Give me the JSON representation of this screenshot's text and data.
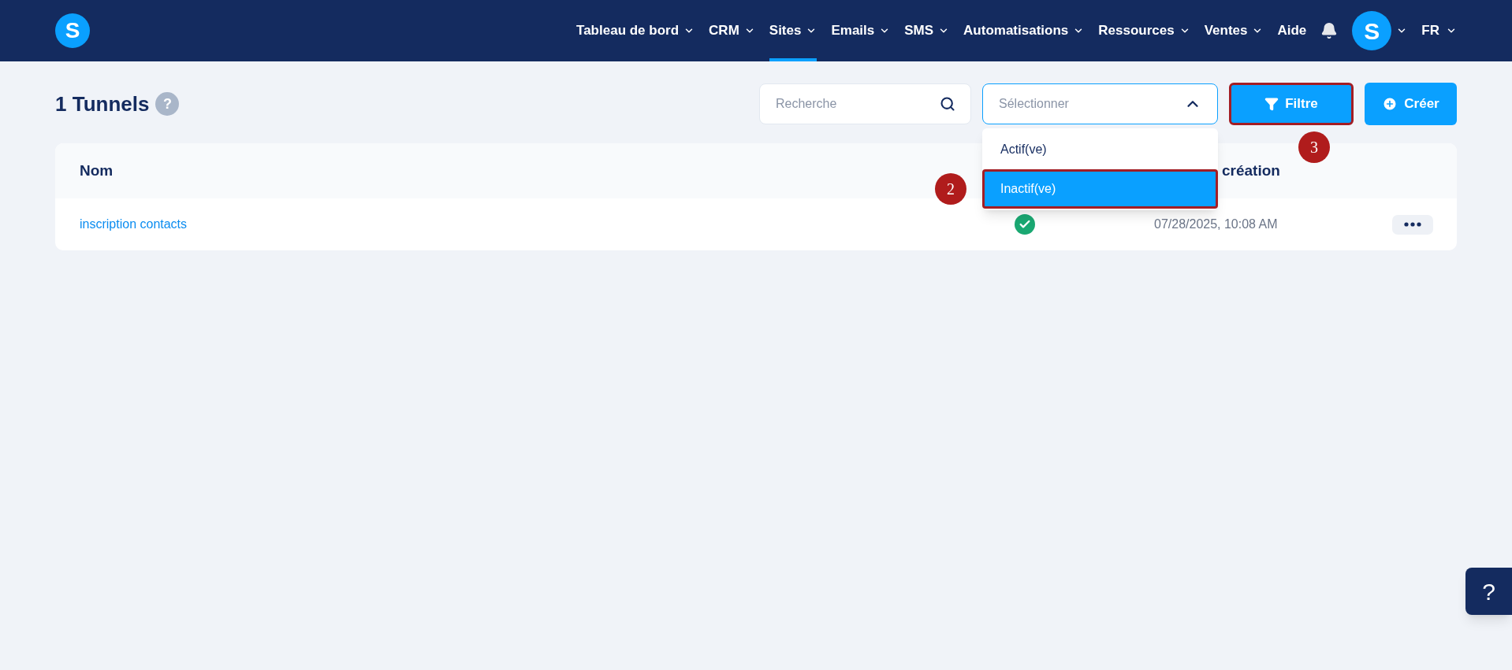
{
  "header": {
    "logo": "S",
    "nav": [
      {
        "label": "Tableau de bord",
        "selected": false,
        "caret": true
      },
      {
        "label": "CRM",
        "selected": false,
        "caret": true
      },
      {
        "label": "Sites",
        "selected": true,
        "caret": true
      },
      {
        "label": "Emails",
        "selected": false,
        "caret": true
      },
      {
        "label": "SMS",
        "selected": false,
        "caret": true
      },
      {
        "label": "Automatisations",
        "selected": false,
        "caret": true
      },
      {
        "label": "Ressources",
        "selected": false,
        "caret": true
      },
      {
        "label": "Ventes",
        "selected": false,
        "caret": true
      },
      {
        "label": "Aide",
        "selected": false,
        "caret": false
      }
    ],
    "avatar": "S",
    "language": "FR"
  },
  "page": {
    "title": "1 Tunnels",
    "help": "?"
  },
  "search": {
    "placeholder": "Recherche"
  },
  "status_select": {
    "placeholder": "Sélectionner",
    "expanded": true,
    "options": [
      {
        "label": "Actif(ve)",
        "selected": false,
        "highlighted": false
      },
      {
        "label": "Inactif(ve)",
        "selected": true,
        "highlighted": true,
        "step": "2"
      }
    ]
  },
  "filter_button": {
    "label": "Filtre",
    "highlighted": true,
    "step": "3"
  },
  "create_button": {
    "label": "Créer"
  },
  "table": {
    "columns": [
      "Nom",
      "création"
    ],
    "rows": [
      {
        "name": "inscription contacts",
        "active": true,
        "date": "07/28/2025, 10:08 AM"
      }
    ]
  },
  "help_button": "?"
}
